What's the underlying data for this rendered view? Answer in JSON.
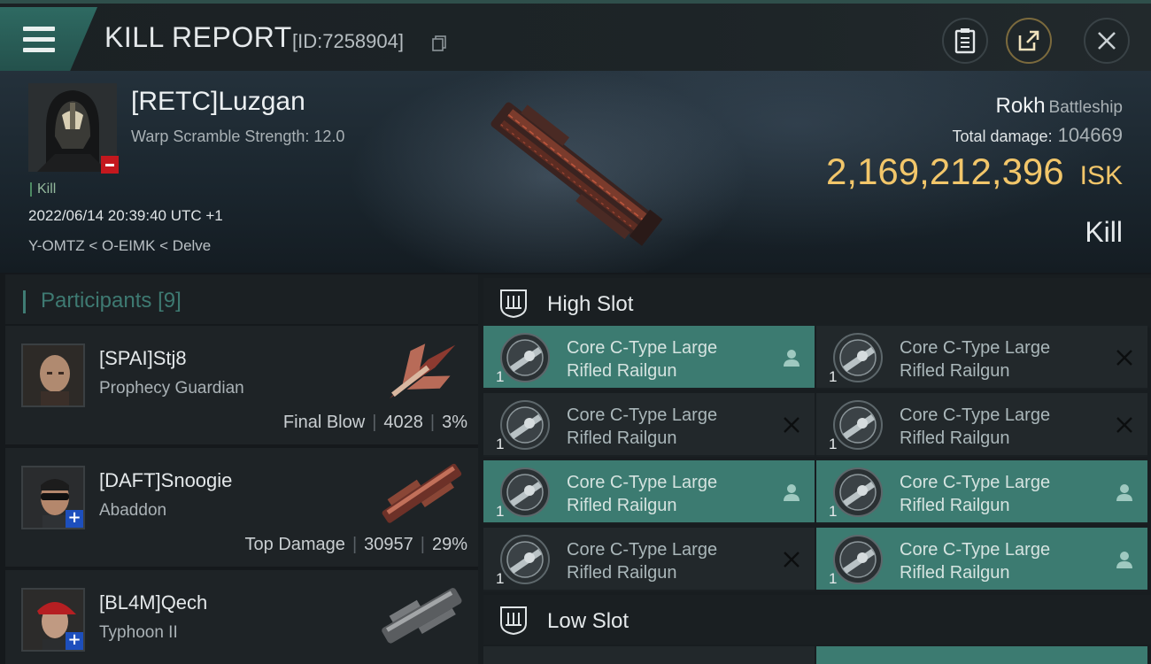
{
  "header": {
    "title": "KILL REPORT",
    "report_id": "[ID:7258904]"
  },
  "victim": {
    "name": "[RETC]Luzgan",
    "warp_scramble": "Warp Scramble Strength: 12.0",
    "tag": "Kill",
    "timestamp": "2022/06/14 20:39:40 UTC +1",
    "location": "Y-OMTZ < O-EIMK < Delve",
    "ship_name": "Rokh",
    "ship_class": "Battleship",
    "total_damage_label": "Total damage:",
    "total_damage": "104669",
    "isk_value": "2,169,212,396",
    "isk_unit": "ISK",
    "result": "Kill"
  },
  "participants": {
    "title": "Participants",
    "count": "[9]",
    "rows": [
      {
        "name": "[SPAI]Stj8",
        "ship": "Prophecy Guardian",
        "role": "Final Blow",
        "damage": "4028",
        "percent": "3%",
        "badge": "none"
      },
      {
        "name": "[DAFT]Snoogie",
        "ship": "Abaddon",
        "role": "Top Damage",
        "damage": "30957",
        "percent": "29%",
        "badge": "plus"
      },
      {
        "name": "[BL4M]Qech",
        "ship": "Typhoon II",
        "badge": "plus"
      }
    ]
  },
  "high_slot": {
    "title": "High Slot",
    "modules": [
      {
        "line1": "Core C-Type Large",
        "line2": "Rifled Railgun",
        "qty": "1",
        "status": "dropped"
      },
      {
        "line1": "Core C-Type Large",
        "line2": "Rifled Railgun",
        "qty": "1",
        "status": "destroyed"
      },
      {
        "line1": "Core C-Type Large",
        "line2": "Rifled Railgun",
        "qty": "1",
        "status": "destroyed"
      },
      {
        "line1": "Core C-Type Large",
        "line2": "Rifled Railgun",
        "qty": "1",
        "status": "destroyed"
      },
      {
        "line1": "Core C-Type Large",
        "line2": "Rifled Railgun",
        "qty": "1",
        "status": "dropped"
      },
      {
        "line1": "Core C-Type Large",
        "line2": "Rifled Railgun",
        "qty": "1",
        "status": "dropped"
      },
      {
        "line1": "Core C-Type Large",
        "line2": "Rifled Railgun",
        "qty": "1",
        "status": "destroyed"
      },
      {
        "line1": "Core C-Type Large",
        "line2": "Rifled Railgun",
        "qty": "1",
        "status": "dropped"
      }
    ]
  },
  "low_slot": {
    "title": "Low Slot"
  },
  "colors": {
    "accent_teal": "#3c7b71",
    "isk_gold": "#f2c66a",
    "badge_red": "#c4181e",
    "badge_blue": "#1d4fbd"
  }
}
